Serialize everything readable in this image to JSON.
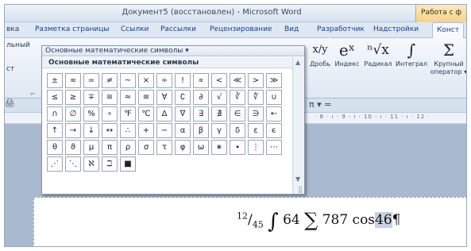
{
  "titlebar": {
    "title": "Документ5 (восстановлен) - Microsoft Word",
    "context_tab": "Работа с ф"
  },
  "tabs": [
    {
      "label": "вка"
    },
    {
      "label": "Разметка страницы"
    },
    {
      "label": "Ссылки"
    },
    {
      "label": "Рассылки"
    },
    {
      "label": "Рецензирование"
    },
    {
      "label": "Вид"
    },
    {
      "label": "Разработчик"
    },
    {
      "label": "Надстройки"
    },
    {
      "label": "Конст"
    }
  ],
  "ribbon_fragments": {
    "left_top": "льный",
    "left_mid": "ст",
    "launcher_glyph": "⌐"
  },
  "math_tools": [
    {
      "glyph": "x/y",
      "label": "Дробь"
    },
    {
      "glyph": "eˣ",
      "label": "Индекс"
    },
    {
      "glyph": "ⁿ√x",
      "label": "Радикал"
    },
    {
      "glyph": "∫",
      "label": "Интеграл"
    },
    {
      "glyph": "Σ",
      "label": "Крупный",
      "label2": "оператор ▾"
    }
  ],
  "toolbar": {
    "pi_row": "π ▾ =",
    "ruler_numbers": "· 8 · ı · 9 · ı · 10 · ı · 11 · ı · 12 ·"
  },
  "gallery": {
    "header": "Основные математические символы ▾",
    "section_title": "Основные математические символы",
    "rows": [
      [
        "±",
        "∞",
        "=",
        "≠",
        "~",
        "×",
        "÷",
        "!",
        "∝",
        "<",
        "≪",
        ">",
        "≫"
      ],
      [
        "≤",
        "≥",
        "∓",
        "≅",
        "≈",
        "≡",
        "∀",
        "∁",
        "∂",
        "√",
        "∛",
        "∜",
        "∪"
      ],
      [
        "∩",
        "∅",
        "%",
        "∘",
        "℉",
        "℃",
        "Δ",
        "∇",
        "∃",
        "∄",
        "∈",
        "∋",
        "←"
      ],
      [
        "↑",
        "→",
        "↓",
        "↔",
        "∴",
        "+",
        "−",
        "α",
        "β",
        "γ",
        "δ",
        "ε",
        "ϵ"
      ],
      [
        "θ",
        "ϑ",
        "μ",
        "π",
        "ρ",
        "σ",
        "τ",
        "φ",
        "ω",
        "∗",
        "∙",
        "⋮",
        "⋯"
      ],
      [
        "⋰",
        "⋱",
        "ℵ",
        "ℶ",
        "■"
      ]
    ],
    "scroll_up": "▲",
    "scroll_down": "▼",
    "resize_grip": "⣿"
  },
  "document": {
    "formula": {
      "numerator": "12",
      "slash": "/",
      "denominator": "45",
      "integral": "∫",
      "integral_arg": "64",
      "sum": "∑",
      "sum_arg": "787",
      "func": "cos",
      "func_arg": "46",
      "pilcrow": "¶"
    }
  },
  "colors": {
    "accent": "#15428b",
    "ribbon_bg": "#dfe8f3",
    "context_tab": "#f2d48a",
    "selection": "#c7d3e3"
  }
}
